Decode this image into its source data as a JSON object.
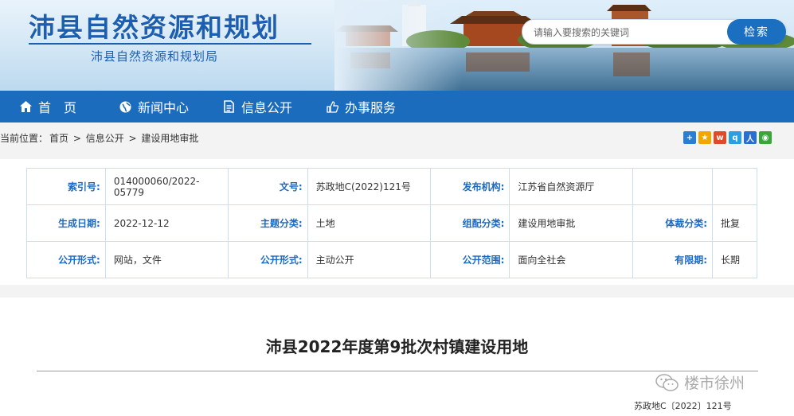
{
  "header": {
    "site_name": "沛县自然资源和规划",
    "site_sub": "沛县自然资源和规划局",
    "search_placeholder": "请输入要搜索的关键词",
    "search_button": "检索"
  },
  "nav": [
    {
      "label": "首　页",
      "icon": "home-icon"
    },
    {
      "label": "新闻中心",
      "icon": "globe-icon"
    },
    {
      "label": "信息公开",
      "icon": "document-icon"
    },
    {
      "label": "办事服务",
      "icon": "thumbs-up-icon"
    }
  ],
  "breadcrumb": {
    "prefix": "当前位置：",
    "items": [
      "首页",
      "信息公开",
      "建设用地审批"
    ],
    "sep": " > "
  },
  "meta": {
    "r1": [
      {
        "k": "索引号:",
        "v": "014000060/2022-05779"
      },
      {
        "k": "文号:",
        "v": "苏政地C(2022)121号"
      },
      {
        "k": "发布机构:",
        "v": "江苏省自然资源厅"
      }
    ],
    "r2": [
      {
        "k": "生成日期:",
        "v": "2022-12-12"
      },
      {
        "k": "主题分类:",
        "v": "土地"
      },
      {
        "k": "组配分类:",
        "v": "建设用地审批"
      },
      {
        "k": "体裁分类:",
        "v": "批复"
      }
    ],
    "r3": [
      {
        "k": "公开形式:",
        "v": "网站，文件"
      },
      {
        "k": "公开形式:",
        "v": "主动公开"
      },
      {
        "k": "公开范围:",
        "v": "面向全社会"
      },
      {
        "k": "有限期:",
        "v": "长期"
      }
    ]
  },
  "article": {
    "title": "沛县2022年度第9批次村镇建设用地",
    "doc_no": "苏政地C〔2022〕121号",
    "watermark": "楼市徐州"
  },
  "colors": {
    "nav": "#1b6cbd",
    "accent": "#1c5fb0",
    "key_text": "#1d6bc0"
  }
}
